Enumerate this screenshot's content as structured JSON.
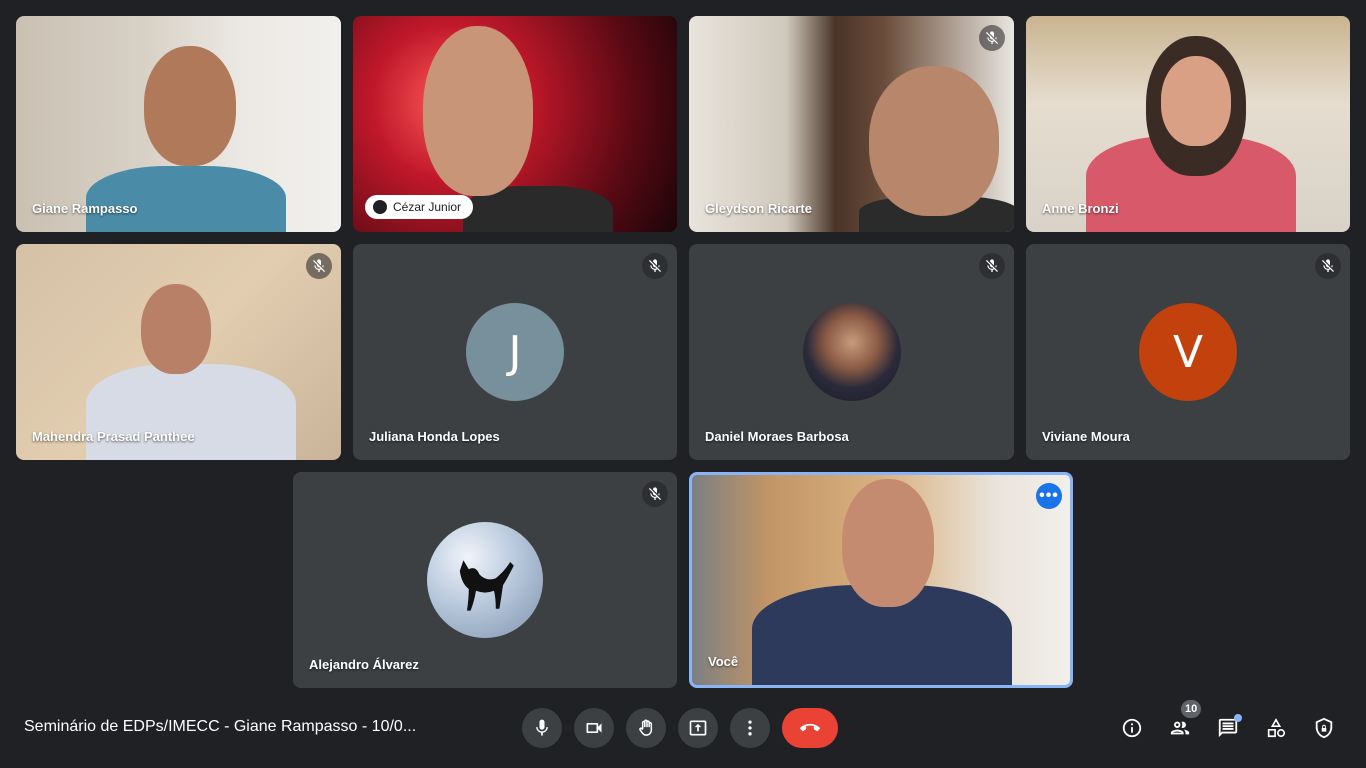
{
  "meeting_title": "Seminário de EDPs/IMECC - Giane Rampasso - 10/0...",
  "participants": [
    {
      "name": "Giane Rampasso"
    },
    {
      "name": "Cézar Junior"
    },
    {
      "name": "Gleydson Ricarte"
    },
    {
      "name": "Anne Bronzi"
    },
    {
      "name": "Mahendra Prasad Panthee"
    },
    {
      "name": "Juliana Honda Lopes",
      "initial": "J",
      "avatar_color": "#78909c"
    },
    {
      "name": "Daniel Moraes Barbosa"
    },
    {
      "name": "Viviane Moura",
      "initial": "V",
      "avatar_color": "#c2410c"
    },
    {
      "name": "Alejandro Álvarez"
    },
    {
      "name": "Você"
    }
  ],
  "participant_count": "10",
  "colors": {
    "end_call": "#ea4335",
    "self_highlight": "#8ab4f8",
    "tile": "#3c4043",
    "background": "#202124"
  }
}
